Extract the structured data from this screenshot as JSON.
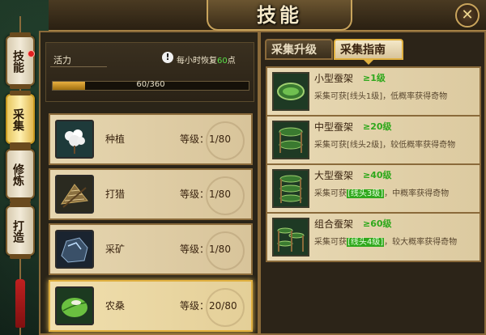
{
  "window": {
    "title": "技能",
    "close_glyph": "✕"
  },
  "side_tabs": [
    {
      "label": "技能",
      "active": false,
      "notify": true
    },
    {
      "label": "采集",
      "active": true,
      "notify": false
    },
    {
      "label": "修炼",
      "active": false,
      "notify": false
    },
    {
      "label": "打造",
      "active": false,
      "notify": false
    }
  ],
  "vitality": {
    "label": "活力",
    "recover_prefix": "每小时恢复",
    "recover_amount": "60",
    "recover_suffix": "点",
    "current": 60,
    "max": 360,
    "value_text": "60/360",
    "fill_fraction": 0.1667
  },
  "skills": [
    {
      "icon": "cotton-flower-icon",
      "name": "种植",
      "level_text": "等级：1/80",
      "selected": false
    },
    {
      "icon": "hunting-net-icon",
      "name": "打猎",
      "level_text": "等级：1/80",
      "selected": false
    },
    {
      "icon": "ore-rock-icon",
      "name": "采矿",
      "level_text": "等级：1/80",
      "selected": false
    },
    {
      "icon": "mulberry-leaf-icon",
      "name": "农桑",
      "level_text": "等级：20/80",
      "selected": true
    }
  ],
  "tabs": [
    {
      "label": "采集升级",
      "active": false
    },
    {
      "label": "采集指南",
      "active": true
    }
  ],
  "guide": [
    {
      "icon": "small-silkworm-rack-icon",
      "name": "小型蚕架",
      "req": "≥1级",
      "desc_a": "采集可获[线头1级]，低概率获得奇物",
      "desc_hl": "",
      "desc_b": ""
    },
    {
      "icon": "medium-silkworm-rack-icon",
      "name": "中型蚕架",
      "req": "≥20级",
      "desc_a": "采集可获[线头2级]，较低概率获得奇物",
      "desc_hl": "",
      "desc_b": ""
    },
    {
      "icon": "large-silkworm-rack-icon",
      "name": "大型蚕架",
      "req": "≥40级",
      "desc_a": "采集可获",
      "desc_hl": "[线头3级]",
      "desc_b": "，中概率获得奇物"
    },
    {
      "icon": "combo-silkworm-rack-icon",
      "name": "组合蚕架",
      "req": "≥60级",
      "desc_a": "采集可获",
      "desc_hl": "[线头4级]",
      "desc_b": "，较大概率获得奇物"
    }
  ]
}
